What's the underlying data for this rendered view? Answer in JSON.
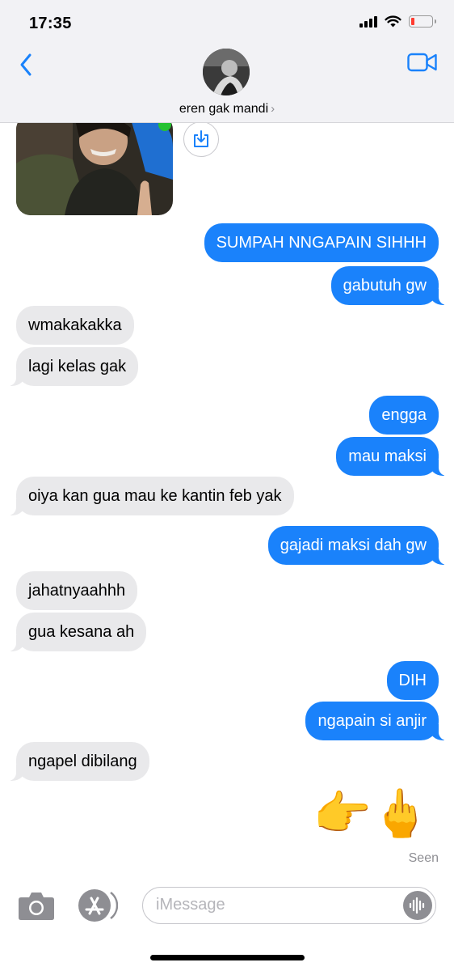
{
  "status_bar": {
    "time": "17:35",
    "battery_level": 0.15,
    "battery_color": "#ff3b30"
  },
  "header": {
    "contact_name": "eren gak mandi",
    "name_chevron": "›",
    "back_icon": "chevron-left-icon",
    "video_icon": "video-camera-icon",
    "accent": "#1a82fb"
  },
  "messages": [
    {
      "type": "image",
      "from": "them"
    },
    {
      "from": "me",
      "text": "SUMPAH NNGAPAIN SIHHH"
    },
    {
      "from": "me",
      "text": "gabutuh gw"
    },
    {
      "from": "them",
      "text": "wmakakakka"
    },
    {
      "from": "them",
      "text": "lagi kelas gak"
    },
    {
      "from": "me",
      "text": "engga"
    },
    {
      "from": "me",
      "text": "mau maksi"
    },
    {
      "from": "them",
      "text": "oiya kan gua mau ke kantin feb yak"
    },
    {
      "from": "me",
      "text": "gajadi maksi dah gw"
    },
    {
      "from": "them",
      "text": "jahatnyaahhh"
    },
    {
      "from": "them",
      "text": "gua kesana ah"
    },
    {
      "from": "me",
      "text": "DIH"
    },
    {
      "from": "me",
      "text": "ngapain si anjir"
    },
    {
      "from": "them",
      "text": "ngapel dibilang"
    },
    {
      "from": "me",
      "text": "👉🖕",
      "type": "emoji"
    }
  ],
  "receipt": "Seen",
  "composer": {
    "placeholder": "iMessage",
    "camera_icon": "camera-icon",
    "apps_icon": "app-store-icon",
    "audio_icon": "audio-waveform-icon"
  },
  "colors": {
    "sent_bubble": "#1a82fb",
    "received_bubble": "#e9e9eb",
    "header_bg": "#f2f2f5"
  }
}
